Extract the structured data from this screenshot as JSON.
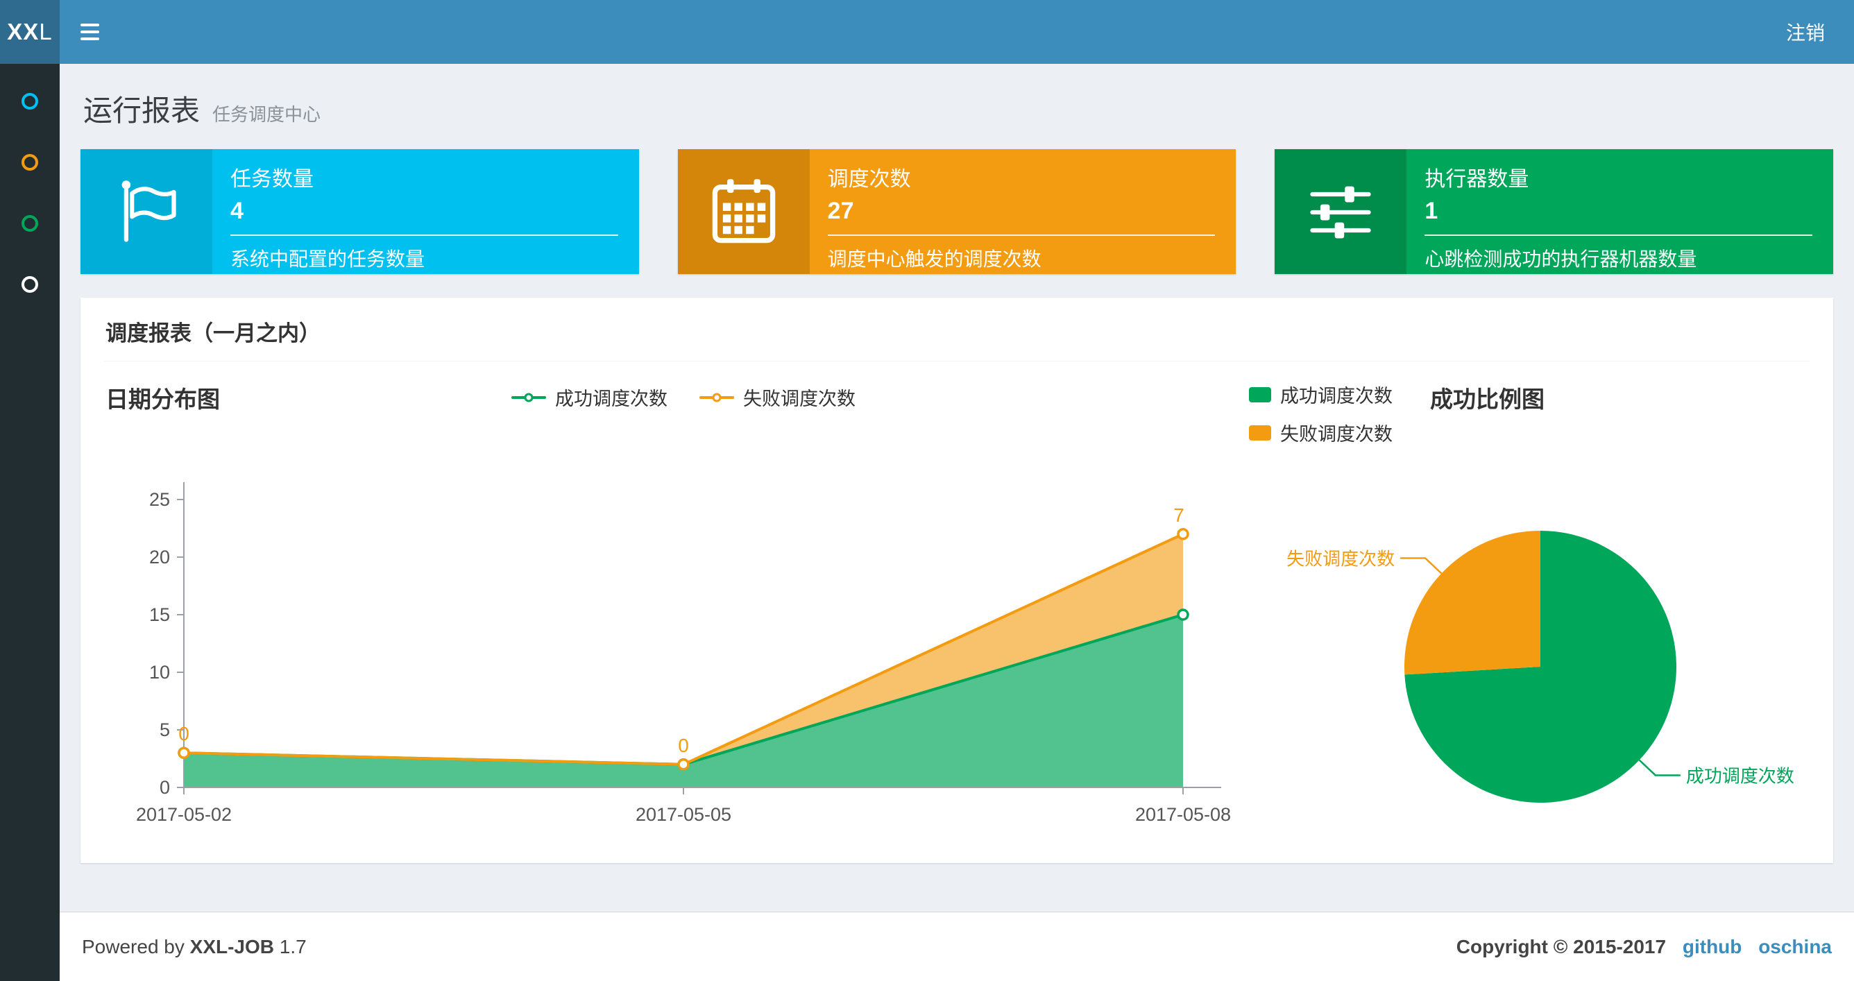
{
  "colors": {
    "navbar_bg": "#3c8dbc",
    "logo_bg": "#2f6a8f",
    "sidebar_bg": "#222d32",
    "content_bg": "#ecf0f5",
    "link": "#3c8dbc",
    "success": "#00a65a",
    "fail": "#f39c12"
  },
  "navbar": {
    "logo_bold": "XX",
    "logo_light": "L",
    "logout": "注销"
  },
  "sidebar": {
    "items": [
      {
        "name": "menu-report",
        "color": "#00c0ef"
      },
      {
        "name": "menu-schedule",
        "color": "#f39c12"
      },
      {
        "name": "menu-log",
        "color": "#00a65a"
      },
      {
        "name": "menu-executor",
        "color": "#ffffff"
      }
    ]
  },
  "header": {
    "title": "运行报表",
    "subtitle": "任务调度中心"
  },
  "info_boxes": [
    {
      "title": "任务数量",
      "value": "4",
      "desc": "系统中配置的任务数量",
      "color": "#00c0ef",
      "icon_color": "#00aed8",
      "icon": "flag-icon"
    },
    {
      "title": "调度次数",
      "value": "27",
      "desc": "调度中心触发的调度次数",
      "color": "#f39c12",
      "icon_color": "#d4860b",
      "icon": "calendar-icon"
    },
    {
      "title": "执行器数量",
      "value": "1",
      "desc": "心跳检测成功的执行器机器数量",
      "color": "#00a65a",
      "icon_color": "#008d4c",
      "icon": "sliders-icon"
    }
  ],
  "panel": {
    "title": "调度报表（一月之内）"
  },
  "chart_data": [
    {
      "type": "area",
      "title": "日期分布图",
      "stacked": true,
      "x": [
        "2017-05-02",
        "2017-05-05",
        "2017-05-08"
      ],
      "series": [
        {
          "name": "成功调度次数",
          "values": [
            3,
            2,
            15
          ],
          "color": "#00a65a"
        },
        {
          "name": "失败调度次数",
          "values": [
            0,
            0,
            7
          ],
          "color": "#f39c12"
        }
      ],
      "ylim": [
        0,
        25
      ],
      "yticks": [
        0,
        5,
        10,
        15,
        20,
        25
      ],
      "point_labels": {
        "series_index": 1,
        "values": [
          "0",
          "0",
          "7"
        ]
      },
      "legend_position": "top-center",
      "grid": false
    },
    {
      "type": "pie",
      "title": "成功比例图",
      "slices": [
        {
          "name": "成功调度次数",
          "value": 20,
          "color": "#00a65a"
        },
        {
          "name": "失败调度次数",
          "value": 7,
          "color": "#f39c12"
        }
      ],
      "legend_position": "top-left"
    }
  ],
  "footer": {
    "powered_prefix": "Powered by",
    "product": "XXL-JOB",
    "version": "1.7",
    "copyright": "Copyright © 2015-2017",
    "links": [
      "github",
      "oschina"
    ]
  }
}
